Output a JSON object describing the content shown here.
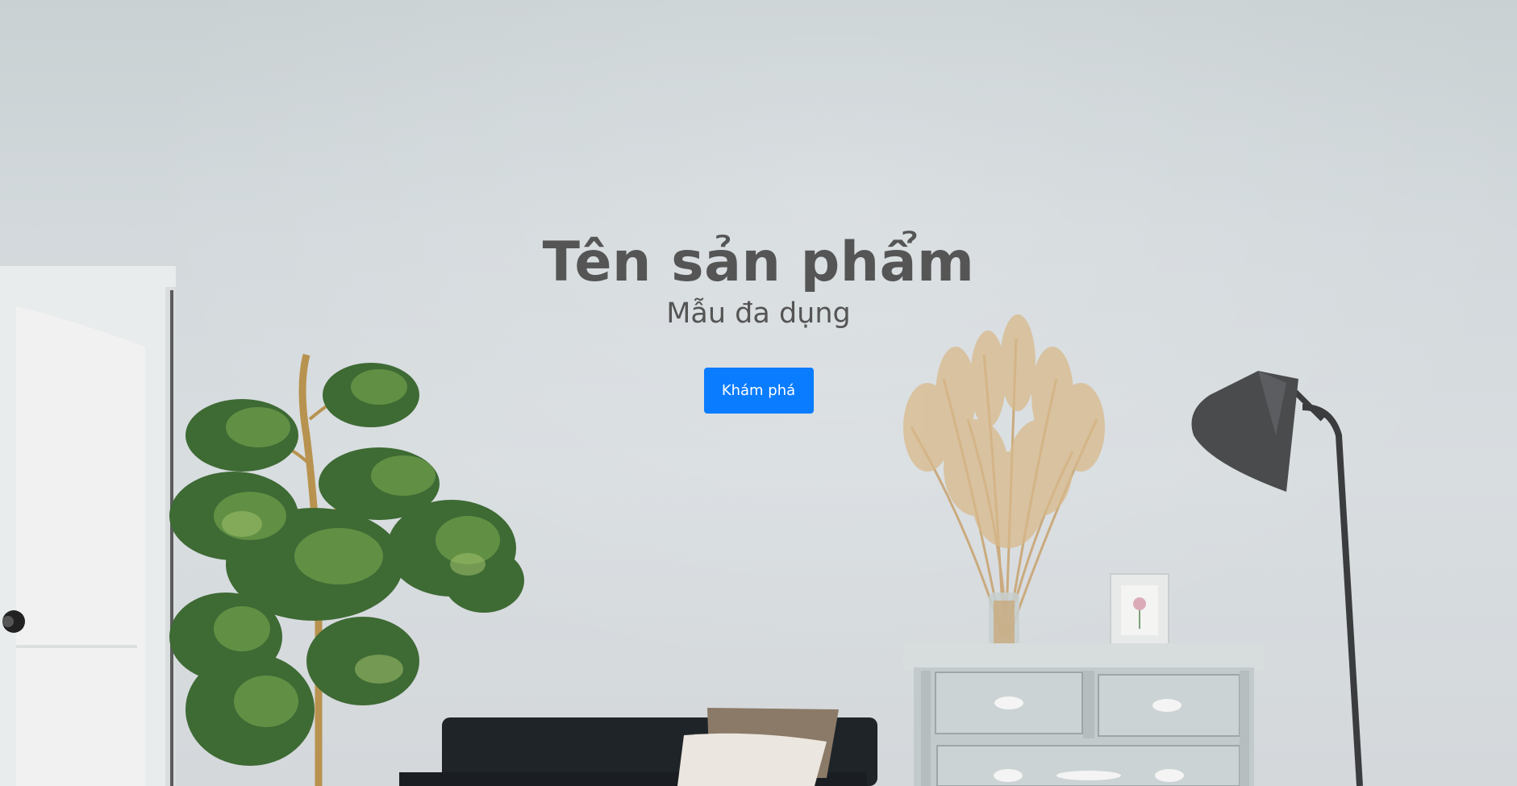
{
  "hero": {
    "title": "Tên sản phẩm",
    "subtitle": "Mẫu đa dụng",
    "cta_label": "Khám phá",
    "accent_color": "#0a7cff",
    "text_color": "#555555",
    "background_image": "living-room-photo"
  }
}
